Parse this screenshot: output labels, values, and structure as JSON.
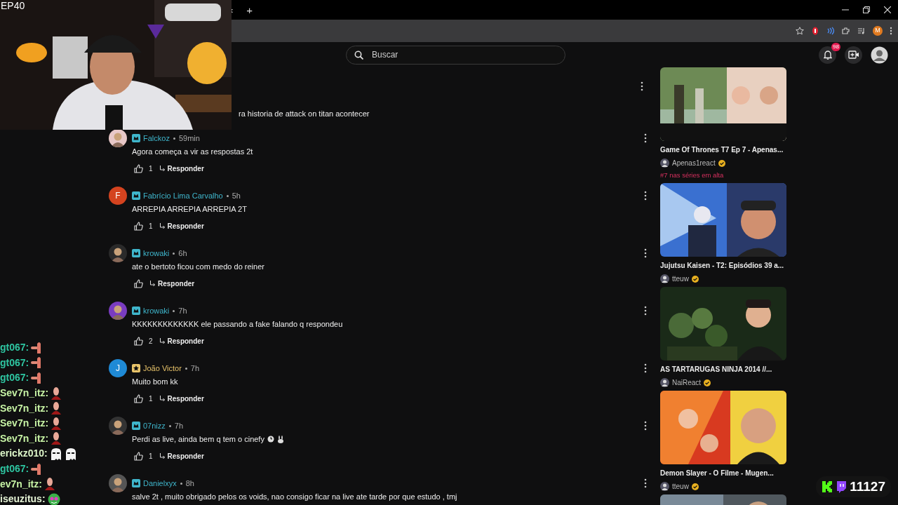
{
  "browser": {
    "tab_arrow": "‹",
    "new_tab": "+",
    "profile_initial": "M"
  },
  "overlay": {
    "episode": "EP40",
    "chat": [
      {
        "user": "gt067:",
        "color": "#2ec4a0",
        "emotes": [
          {
            "kind": "hand"
          }
        ]
      },
      {
        "user": "gt067:",
        "color": "#2ec4a0",
        "emotes": [
          {
            "kind": "hand"
          }
        ]
      },
      {
        "user": "gt067:",
        "color": "#2ec4a0",
        "emotes": [
          {
            "kind": "hand"
          }
        ]
      },
      {
        "user": "Sev7n_itz:",
        "color": "#c6f2a4",
        "emotes": [
          {
            "kind": "figure"
          }
        ]
      },
      {
        "user": "Sev7n_itz:",
        "color": "#c6f2a4",
        "emotes": [
          {
            "kind": "figure"
          }
        ]
      },
      {
        "user": "Sev7n_itz:",
        "color": "#c6f2a4",
        "emotes": [
          {
            "kind": "figure"
          }
        ]
      },
      {
        "user": "Sev7n_itz:",
        "color": "#c6f2a4",
        "emotes": [
          {
            "kind": "figure"
          }
        ]
      },
      {
        "user": "erickz010:",
        "color": "#dcf5c8",
        "emotes": [
          {
            "kind": "ghost"
          },
          {
            "kind": "ghost"
          }
        ]
      },
      {
        "user": "gt067:",
        "color": "#2ec4a0",
        "emotes": [
          {
            "kind": "hand"
          }
        ]
      },
      {
        "user": "ev7n_itz:",
        "color": "#c6f2a4",
        "emotes": [
          {
            "kind": "figure"
          }
        ]
      },
      {
        "user": "iseuzitus:",
        "color": "#e4f2d4",
        "emotes": [
          {
            "kind": "frog"
          }
        ]
      }
    ],
    "viewers": "11127"
  },
  "site": {
    "search": {
      "placeholder": "Buscar"
    },
    "notifications": "98"
  },
  "comments": [
    {
      "kind": "partial",
      "text": "ra historia de attack on titan acontecer"
    },
    {
      "kind": "full",
      "name": "Falckoz",
      "time": "59min",
      "badge": {
        "kind": "crown"
      },
      "avatar": {
        "kind": "picture"
      },
      "text": "Agora começa a vir as respostas 2t",
      "likes": "1",
      "reply": "Responder"
    },
    {
      "kind": "full",
      "name": "Fabrício Lima Carvalho",
      "time": "5h",
      "badge": {
        "kind": "crown"
      },
      "avatar": {
        "kind": "letter",
        "letter": "F",
        "color": "#d4431f"
      },
      "text": "ARREPIA ARREPIA ARREPIA 2T",
      "likes": "1",
      "reply": "Responder"
    },
    {
      "kind": "full",
      "name": "krowaki",
      "time": "6h",
      "badge": {
        "kind": "crown"
      },
      "avatar": {
        "kind": "picture"
      },
      "text": "ate o bertoto ficou com medo do reiner",
      "reply": "Responder"
    },
    {
      "kind": "full",
      "name": "krowaki",
      "time": "7h",
      "badge": {
        "kind": "crown"
      },
      "avatar": {
        "kind": "picture"
      },
      "text": "KKKKKKKKKKKKK ele passando a fake falando q respondeu",
      "likes": "2",
      "reply": "Responder"
    },
    {
      "kind": "full",
      "name": "João Victor",
      "time": "7h",
      "badge": {
        "kind": "star"
      },
      "avatar": {
        "kind": "letter",
        "letter": "J",
        "color": "#1f8ad6"
      },
      "text": "Muito bom kk",
      "likes": "1",
      "reply": "Responder"
    },
    {
      "kind": "full",
      "name": "07nizz",
      "time": "7h",
      "badge": {
        "kind": "crown"
      },
      "avatar": {
        "kind": "picture"
      },
      "text": "Perdi as live, ainda bem q tem o cinefy",
      "emojis": [
        {
          "kind": "clock"
        },
        {
          "kind": "bunny"
        }
      ],
      "likes": "1",
      "reply": "Responder"
    },
    {
      "kind": "full",
      "name": "Danielxyx",
      "time": "8h",
      "badge": {
        "kind": "crown"
      },
      "avatar": {
        "kind": "picture"
      },
      "text": "salve 2t , muito obrigado pelos os voids, nao consigo ficar na live ate tarde por que estudo , tmj"
    }
  ],
  "videos": [
    {
      "thumbnail": {
        "kind": "picture"
      },
      "title": "Game Of Thrones T7 Ep 7 - Apenas...",
      "channel": "Apenas1react",
      "verified": true,
      "trend": "#7 nas séries em alta"
    },
    {
      "thumbnail": {
        "kind": "picture"
      },
      "title": "Jujutsu Kaisen - T2: Episódios 39 a...",
      "channel": "tteuw",
      "verified": true
    },
    {
      "thumbnail": {
        "kind": "picture"
      },
      "title": "AS TARTARUGAS NINJA 2014 //...",
      "channel": "NaiReact",
      "verified": true
    },
    {
      "thumbnail": {
        "kind": "picture"
      },
      "title": "Demon Slayer - O Filme - Mugen...",
      "channel": "tteuw",
      "verified": true
    },
    {
      "thumbnail": {
        "kind": "picture"
      }
    }
  ]
}
